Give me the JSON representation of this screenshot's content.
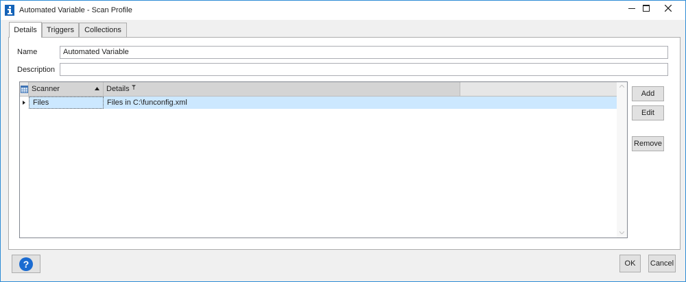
{
  "window": {
    "title": "Automated Variable - Scan Profile",
    "accent": "#2d8bd6"
  },
  "tabs": [
    {
      "label": "Details",
      "active": true
    },
    {
      "label": "Triggers",
      "active": false
    },
    {
      "label": "Collections",
      "active": false
    }
  ],
  "form": {
    "name_label": "Name",
    "name_value": "Automated Variable",
    "description_label": "Description",
    "description_value": ""
  },
  "grid": {
    "columns": [
      "Scanner",
      "Details"
    ],
    "sort": "Scanner ascending",
    "rows": [
      {
        "scanner": "Files",
        "details": "Files in C:\\funconfig.xml",
        "selected": true
      }
    ],
    "selection_color": "#cce8ff"
  },
  "side_buttons": {
    "add": "Add",
    "edit": "Edit",
    "remove": "Remove"
  },
  "footer": {
    "help_symbol": "?",
    "ok": "OK",
    "cancel": "Cancel"
  },
  "icons": {
    "app": "info-icon",
    "grid_corner": "table-icon",
    "sort": "sort-ascending-icon",
    "filter": "filter-icon",
    "row_pointer": "row-pointer-icon"
  }
}
